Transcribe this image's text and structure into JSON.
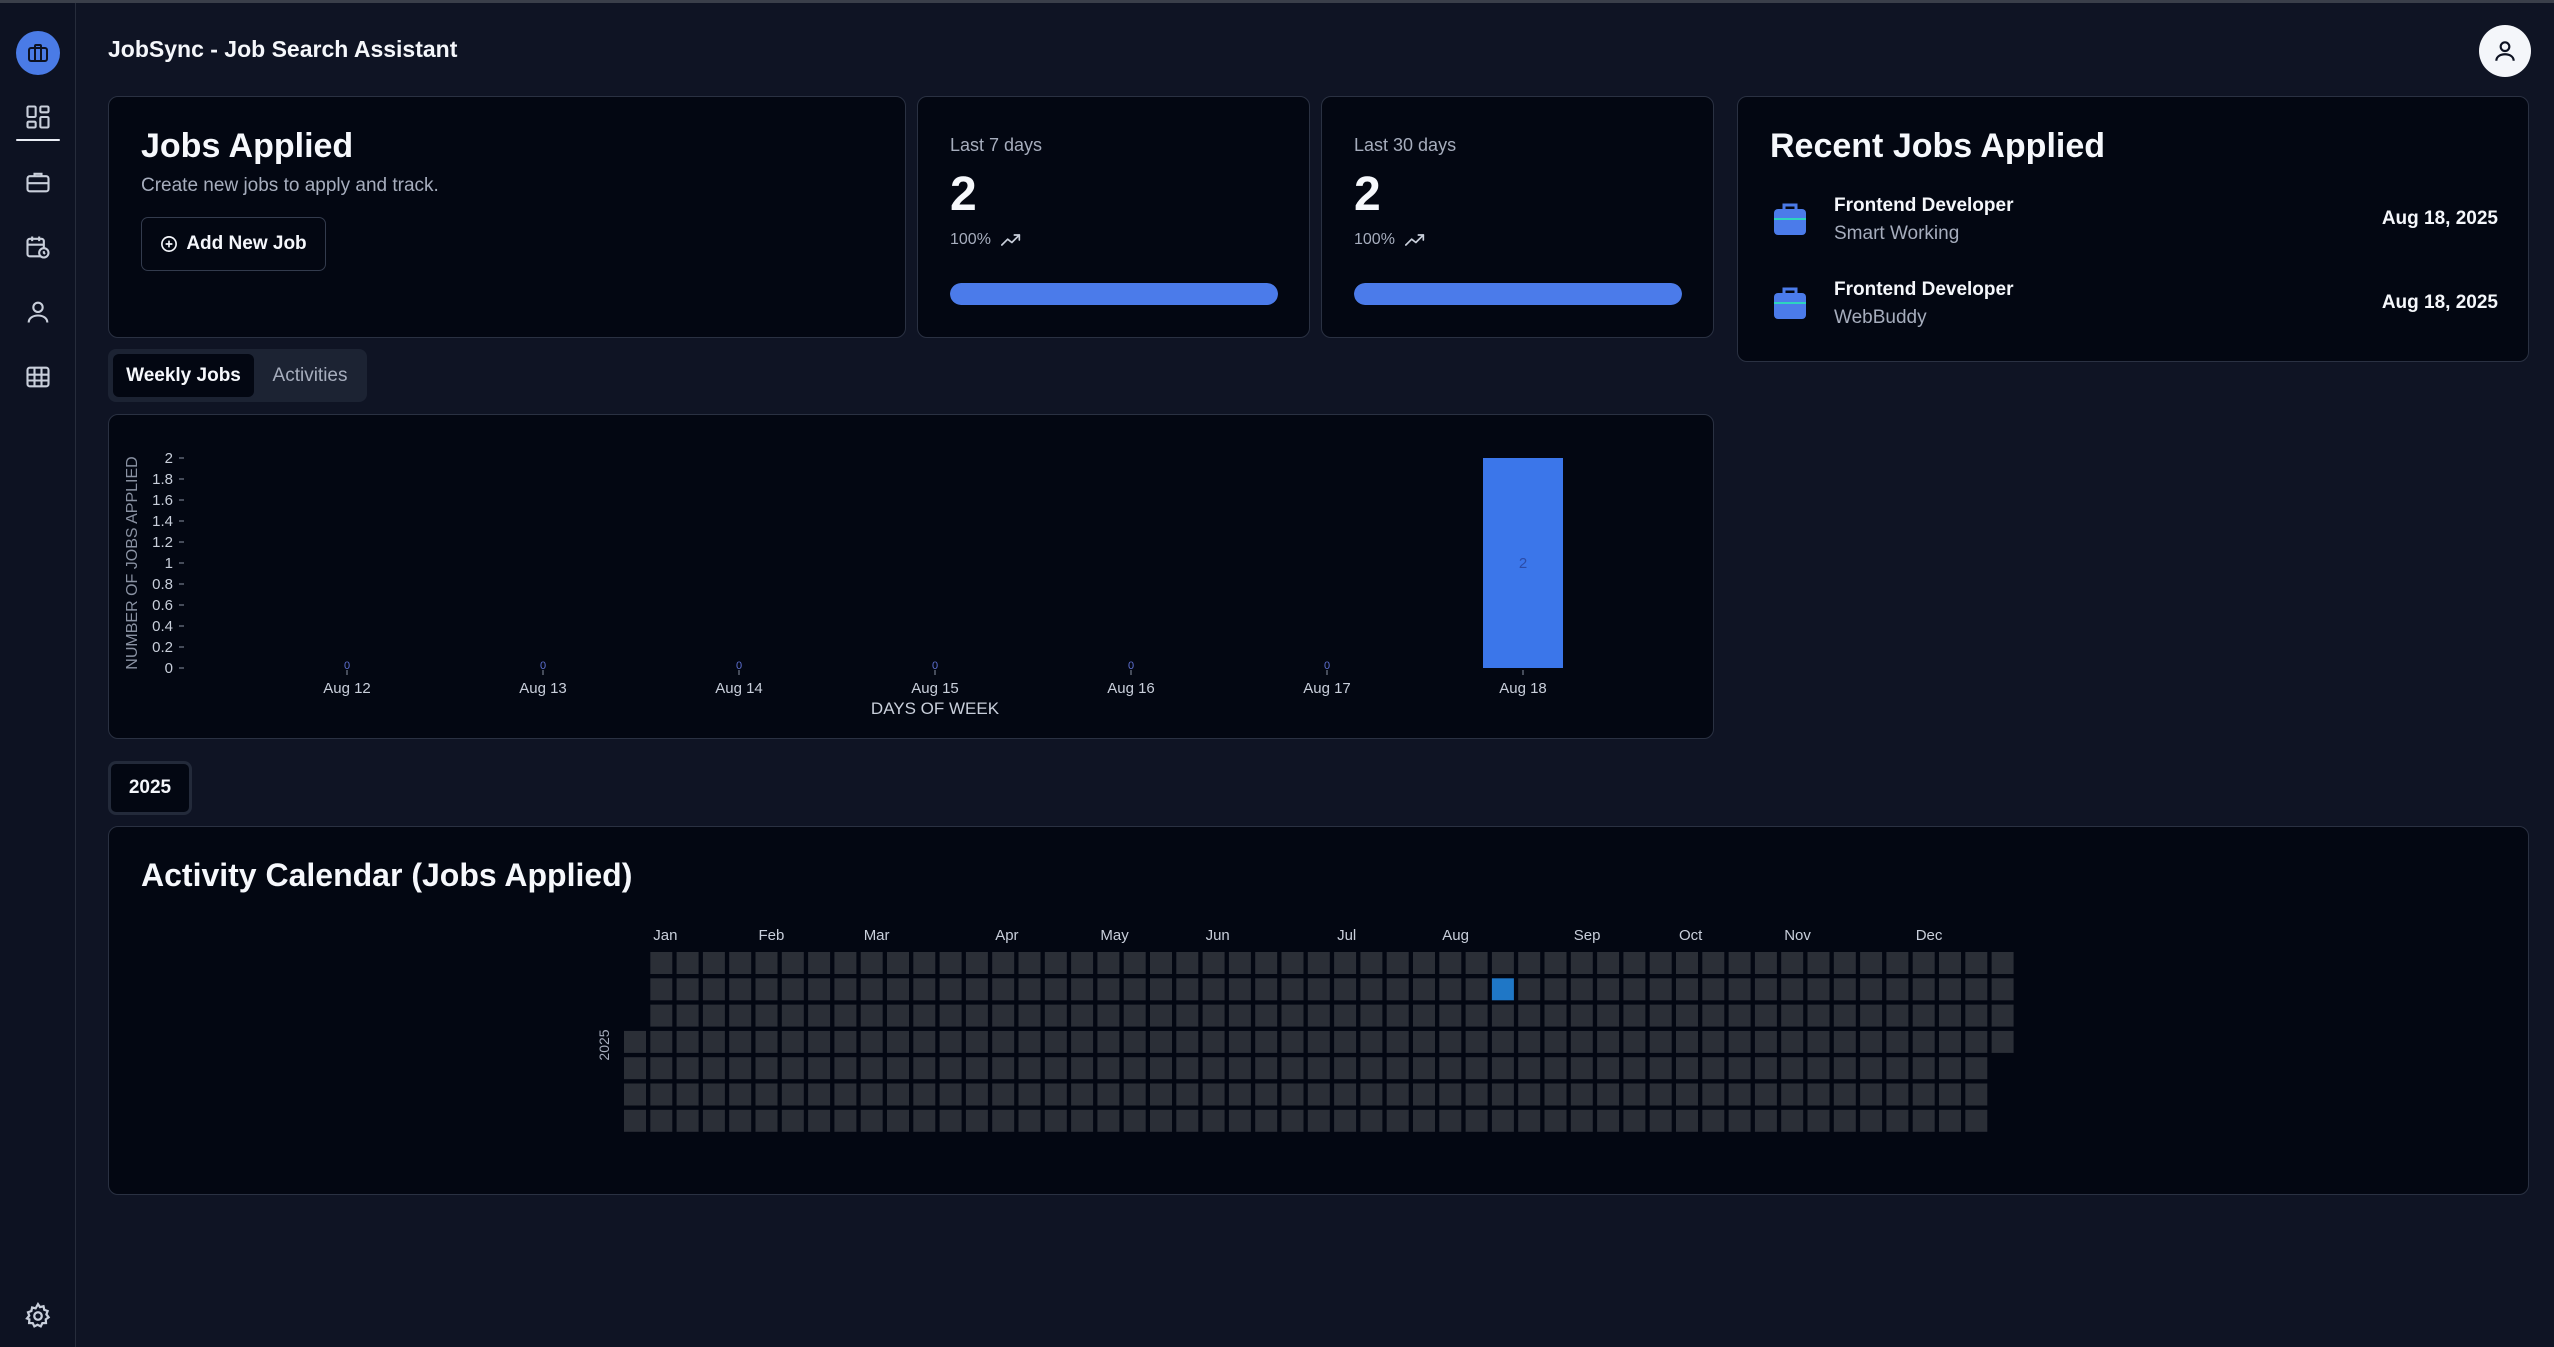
{
  "app": {
    "title": "JobSync - Job Search Assistant"
  },
  "sidebar": {
    "items": [
      {
        "name": "dashboard"
      },
      {
        "name": "jobs"
      },
      {
        "name": "activities"
      },
      {
        "name": "profile"
      },
      {
        "name": "admin"
      }
    ]
  },
  "jobs_card": {
    "title": "Jobs Applied",
    "subtitle": "Create new jobs to apply and track.",
    "add_button": "Add New Job"
  },
  "stats": [
    {
      "label": "Last 7 days",
      "value": "2",
      "percent": "100%",
      "progress": 1.0
    },
    {
      "label": "Last 30 days",
      "value": "2",
      "percent": "100%",
      "progress": 1.0
    }
  ],
  "recent": {
    "title": "Recent Jobs Applied",
    "items": [
      {
        "title": "Frontend Developer",
        "company": "Smart Working",
        "date": "Aug 18, 2025"
      },
      {
        "title": "Frontend Developer",
        "company": "WebBuddy",
        "date": "Aug 18, 2025"
      }
    ]
  },
  "tabs": [
    {
      "label": "Weekly Jobs",
      "active": true
    },
    {
      "label": "Activities",
      "active": false
    }
  ],
  "chart_data": {
    "type": "bar",
    "categories": [
      "Aug 12",
      "Aug 13",
      "Aug 14",
      "Aug 15",
      "Aug 16",
      "Aug 17",
      "Aug 18"
    ],
    "values": [
      0,
      0,
      0,
      0,
      0,
      0,
      2
    ],
    "xlabel": "DAYS OF WEEK",
    "ylabel": "NUMBER OF JOBS APPLIED",
    "yticks": [
      "0",
      "0.2",
      "0.4",
      "0.6",
      "0.8",
      "1",
      "1.2",
      "1.4",
      "1.6",
      "1.8",
      "2"
    ],
    "ylim": [
      0,
      2
    ],
    "bar_color": "#3b76ea",
    "grid": false,
    "legend": "none"
  },
  "year_filter": "2025",
  "calendar": {
    "title": "Activity Calendar (Jobs Applied)",
    "year_label": "2025",
    "months": [
      "Jan",
      "Feb",
      "Mar",
      "Apr",
      "May",
      "Jun",
      "Jul",
      "Aug",
      "Sep",
      "Oct",
      "Nov",
      "Dec"
    ],
    "active_days": [
      {
        "date": "Aug 18",
        "count": 2
      }
    ],
    "empty_color": "#2b2f37",
    "active_color": "#1f77c6"
  }
}
